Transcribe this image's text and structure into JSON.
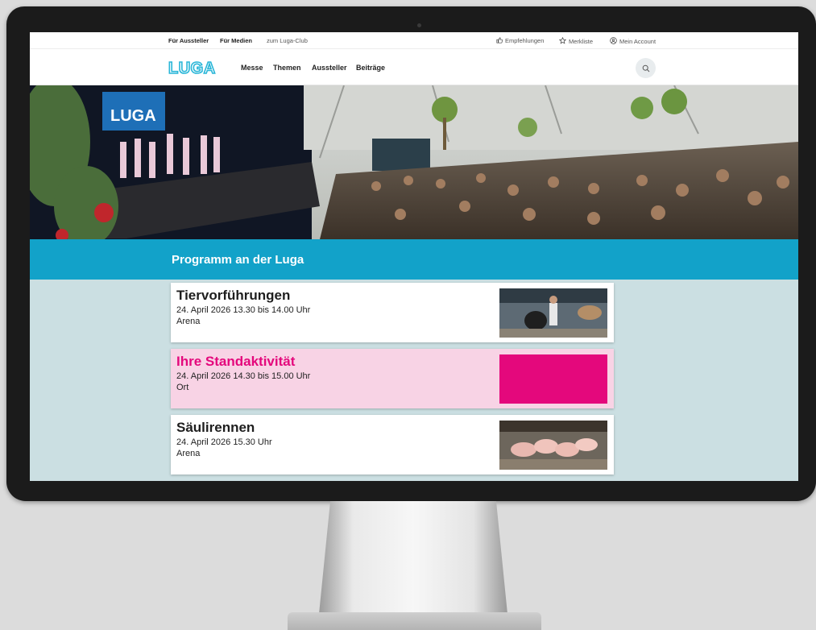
{
  "topbar": {
    "left_links": [
      "Für Aussteller",
      "Für Medien",
      "zum Luga-Club"
    ],
    "right_links": [
      "Empfehlungen",
      "Merkliste",
      "Mein Account"
    ]
  },
  "header": {
    "logo_text": "LUGA",
    "nav": [
      "Messe",
      "Themen",
      "Aussteller",
      "Beiträge"
    ],
    "search_icon": "search-icon"
  },
  "hero": {
    "stage_banner": "LUGA"
  },
  "program": {
    "title": "Programm an der Luga",
    "items": [
      {
        "title": "Tiervorführungen",
        "date": "24. April 2026 13.30 bis 14.00 Uhr",
        "location": "Arena",
        "highlight": false
      },
      {
        "title": "Ihre Standaktivität",
        "date": "24. April 2026 14.30 bis 15.00 Uhr",
        "location": "Ort",
        "highlight": true
      },
      {
        "title": "Säulirennen",
        "date": "24. April 2026 15.30 Uhr",
        "location": "Arena",
        "highlight": false
      }
    ]
  },
  "colors": {
    "accent_blue": "#12a2c9",
    "highlight_pink": "#e4087c",
    "highlight_bg": "#f8d3e5",
    "page_bg": "#cbdfe2"
  }
}
